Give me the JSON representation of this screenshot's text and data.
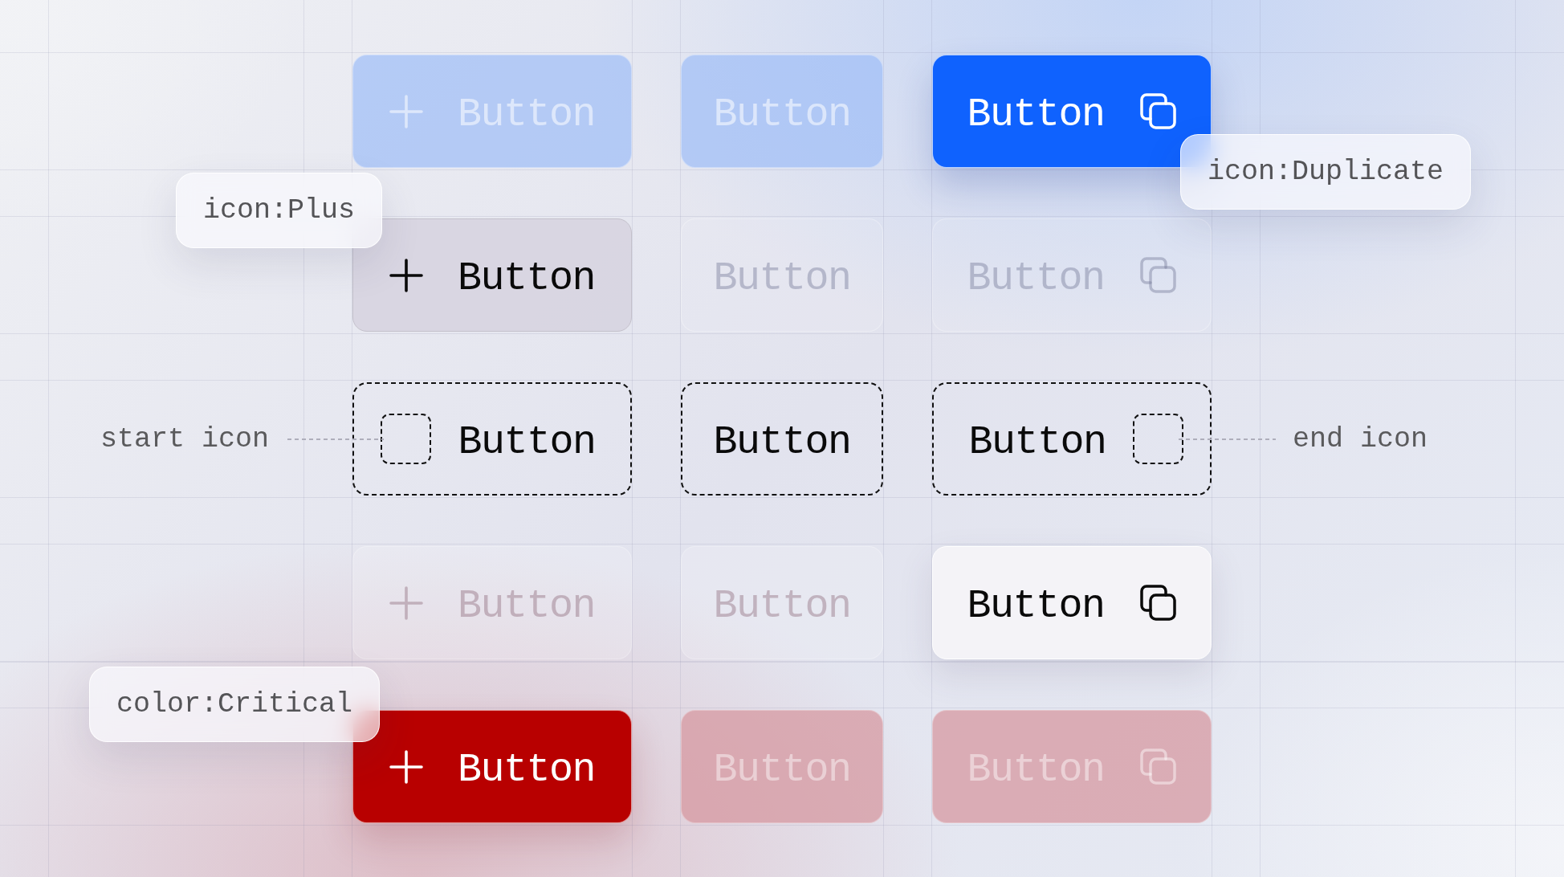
{
  "button_rows": [
    {
      "kind": "primary",
      "buttons": [
        {
          "kind": "leading-icon",
          "label": "Button",
          "disabled": true
        },
        {
          "kind": "text",
          "label": "Button",
          "disabled": true
        },
        {
          "kind": "trailing-icon",
          "label": "Button",
          "disabled": false
        }
      ]
    },
    {
      "kind": "secondary",
      "buttons": [
        {
          "kind": "leading-icon",
          "label": "Button",
          "disabled": false
        },
        {
          "kind": "text",
          "label": "Button",
          "disabled": true
        },
        {
          "kind": "trailing-icon",
          "label": "Button",
          "disabled": true
        }
      ]
    },
    {
      "kind": "placeholder",
      "callouts": [
        "start icon",
        "end icon"
      ],
      "buttons": [
        {
          "kind": "leading-icon",
          "label": "Button"
        },
        {
          "kind": "text",
          "label": "Button"
        },
        {
          "kind": "trailing-icon",
          "label": "Button"
        }
      ]
    },
    {
      "kind": "tertiary",
      "buttons": [
        {
          "kind": "leading-icon",
          "label": "Button",
          "disabled": true
        },
        {
          "kind": "text",
          "label": "Button",
          "disabled": true
        },
        {
          "kind": "trailing-icon",
          "label": "Button",
          "disabled": false
        }
      ]
    },
    {
      "kind": "critical",
      "buttons": [
        {
          "kind": "leading-icon",
          "label": "Button",
          "disabled": false
        },
        {
          "kind": "text",
          "label": "Button",
          "disabled": true
        },
        {
          "kind": "trailing-icon",
          "label": "Button",
          "disabled": true
        }
      ]
    }
  ],
  "tags": [
    "icon:Plus",
    "icon:Duplicate",
    "color:Critical"
  ]
}
